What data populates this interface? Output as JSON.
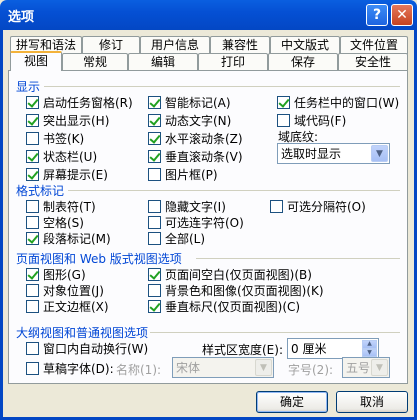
{
  "window": {
    "title": "选项",
    "help": "?",
    "close": "✕"
  },
  "tabs_row1": [
    "拼写和语法",
    "修订",
    "用户信息",
    "兼容性",
    "中文版式",
    "文件位置"
  ],
  "tabs_row2": [
    "视图",
    "常规",
    "编辑",
    "打印",
    "保存",
    "安全性"
  ],
  "show": {
    "heading": "显示",
    "col1": [
      {
        "label": "启动任务窗格(R)",
        "checked": true
      },
      {
        "label": "突出显示(H)",
        "checked": true
      },
      {
        "label": "书签(K)",
        "checked": false
      },
      {
        "label": "状态栏(U)",
        "checked": true
      },
      {
        "label": "屏幕提示(E)",
        "checked": true
      }
    ],
    "col2": [
      {
        "label": "智能标记(A)",
        "checked": true
      },
      {
        "label": "动态文字(N)",
        "checked": true
      },
      {
        "label": "水平滚动条(Z)",
        "checked": true
      },
      {
        "label": "垂直滚动条(V)",
        "checked": true
      },
      {
        "label": "图片框(P)",
        "checked": false
      }
    ],
    "col3": [
      {
        "label": "任务栏中的窗口(W)",
        "checked": true
      },
      {
        "label": "域代码(F)",
        "checked": false
      }
    ],
    "field_shading_label": "域底纹:",
    "field_shading_value": "选取时显示"
  },
  "format_marks": {
    "heading": "格式标记",
    "col1": [
      {
        "label": "制表符(T)",
        "checked": false
      },
      {
        "label": "空格(S)",
        "checked": false
      },
      {
        "label": "段落标记(M)",
        "checked": true
      }
    ],
    "col2": [
      {
        "label": "隐藏文字(I)",
        "checked": false
      },
      {
        "label": "可选连字符(O)",
        "checked": false
      },
      {
        "label": "全部(L)",
        "checked": false
      }
    ],
    "col3": [
      {
        "label": "可选分隔符(O)",
        "checked": false
      }
    ]
  },
  "page_view": {
    "heading": "页面视图和 Web 版式视图选项",
    "col1": [
      {
        "label": "图形(G)",
        "checked": true
      },
      {
        "label": "对象位置(J)",
        "checked": false
      },
      {
        "label": "正文边框(X)",
        "checked": false
      }
    ],
    "col2": [
      {
        "label": "页面间空白(仅页面视图)(B)",
        "checked": true
      },
      {
        "label": "背景色和图像(仅页面视图)(K)",
        "checked": false
      },
      {
        "label": "垂直标尺(仅页面视图)(C)",
        "checked": true
      }
    ]
  },
  "outline": {
    "heading": "大纲视图和普通视图选项",
    "wrap": {
      "label": "窗口内自动换行(W)",
      "checked": false
    },
    "draft": {
      "label": "草稿字体(D):",
      "checked": false
    },
    "style_width_label": "样式区宽度(E):",
    "style_width_value": "0 厘米",
    "name_label": "名称(1):",
    "name_value": "宋体",
    "size_label": "字号(2):",
    "size_value": "五号"
  },
  "buttons": {
    "ok": "确定",
    "cancel": "取消"
  }
}
